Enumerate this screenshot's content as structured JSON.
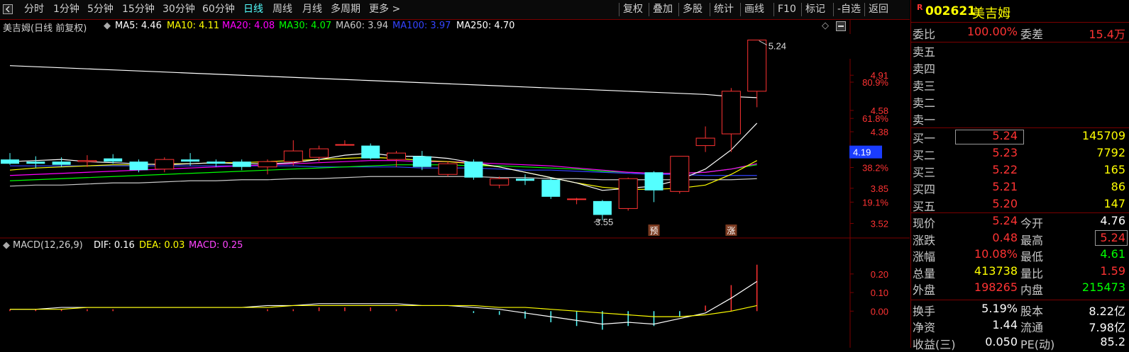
{
  "toolbar": {
    "left_buttons": [
      "分时",
      "1分钟",
      "5分钟",
      "15分钟",
      "30分钟",
      "60分钟",
      "日线",
      "周线",
      "月线",
      "多周期",
      "更多 >"
    ],
    "active": "日线",
    "right_buttons": [
      "复权",
      "叠加",
      "多股",
      "统计",
      "画线",
      "F10",
      "标记",
      "-自选",
      "返回"
    ]
  },
  "chart": {
    "title": "美吉姆(日线 前复权)",
    "ma": [
      {
        "label": "MA5: 4.46",
        "color": "#ffffff"
      },
      {
        "label": "MA10: 4.11",
        "color": "#ffff00"
      },
      {
        "label": "MA20: 4.08",
        "color": "#ff00ff"
      },
      {
        "label": "MA30: 4.07",
        "color": "#00ff00"
      },
      {
        "label": "MA60: 3.94",
        "color": "#c8c8c8"
      },
      {
        "label": "MA100: 3.97",
        "color": "#3344ff"
      },
      {
        "label": "MA250: 4.70",
        "color": "#ffffff"
      }
    ],
    "price_axis": [
      {
        "label": "4.91",
        "v": 4.91,
        "color": "#ff3333"
      },
      {
        "label": "80.9%",
        "v": 4.845,
        "color": "#ff3333"
      },
      {
        "label": "4.58",
        "v": 4.58,
        "color": "#ff3333"
      },
      {
        "label": "61.8%",
        "v": 4.505,
        "color": "#ff3333"
      },
      {
        "label": "4.38",
        "v": 4.38,
        "color": "#ff3333"
      },
      {
        "label": "38.2%",
        "v": 4.045,
        "color": "#ff3333"
      },
      {
        "label": "3.85",
        "v": 3.85,
        "color": "#ff3333"
      },
      {
        "label": "19.1%",
        "v": 3.72,
        "color": "#ff3333"
      },
      {
        "label": "3.52",
        "v": 3.52,
        "color": "#ff3333"
      }
    ],
    "current_price_tag": "4.19",
    "high_label": "5.24",
    "low_label": "3.55",
    "markers": [
      {
        "text": "预",
        "index": 25
      },
      {
        "text": "涨",
        "index": 28
      }
    ],
    "macd_legend": {
      "name": "MACD(12,26,9)",
      "dif": "DIF: 0.16",
      "dea": "DEA: 0.03",
      "macd": "MACD: 0.25"
    },
    "macd_axis": [
      "0.20",
      "0.10",
      "0.00"
    ]
  },
  "chart_data": {
    "type": "candlestick",
    "ohlc": [
      {
        "o": 4.12,
        "h": 4.18,
        "l": 4.07,
        "c": 4.08
      },
      {
        "o": 4.1,
        "h": 4.15,
        "l": 4.04,
        "c": 4.08
      },
      {
        "o": 4.1,
        "h": 4.14,
        "l": 4.05,
        "c": 4.07
      },
      {
        "o": 4.1,
        "h": 4.16,
        "l": 4.05,
        "c": 4.11
      },
      {
        "o": 4.13,
        "h": 4.17,
        "l": 4.08,
        "c": 4.1
      },
      {
        "o": 4.1,
        "h": 4.12,
        "l": 4.0,
        "c": 4.02
      },
      {
        "o": 4.03,
        "h": 4.14,
        "l": 4.0,
        "c": 4.12
      },
      {
        "o": 4.12,
        "h": 4.18,
        "l": 4.06,
        "c": 4.1
      },
      {
        "o": 4.1,
        "h": 4.12,
        "l": 4.05,
        "c": 4.08
      },
      {
        "o": 4.1,
        "h": 4.12,
        "l": 4.02,
        "c": 4.05
      },
      {
        "o": 4.05,
        "h": 4.12,
        "l": 3.98,
        "c": 4.1
      },
      {
        "o": 4.1,
        "h": 4.3,
        "l": 4.06,
        "c": 4.2
      },
      {
        "o": 4.14,
        "h": 4.25,
        "l": 4.1,
        "c": 4.22
      },
      {
        "o": 4.26,
        "h": 4.3,
        "l": 4.25,
        "c": 4.26
      },
      {
        "o": 4.25,
        "h": 4.27,
        "l": 4.12,
        "c": 4.13
      },
      {
        "o": 4.12,
        "h": 4.2,
        "l": 4.05,
        "c": 4.18
      },
      {
        "o": 4.15,
        "h": 4.2,
        "l": 4.02,
        "c": 4.05
      },
      {
        "o": 3.98,
        "h": 4.1,
        "l": 3.96,
        "c": 4.08
      },
      {
        "o": 4.1,
        "h": 4.12,
        "l": 3.93,
        "c": 3.95
      },
      {
        "o": 3.88,
        "h": 3.96,
        "l": 3.85,
        "c": 3.94
      },
      {
        "o": 3.94,
        "h": 3.98,
        "l": 3.88,
        "c": 3.92
      },
      {
        "o": 3.93,
        "h": 3.95,
        "l": 3.75,
        "c": 3.77
      },
      {
        "o": 3.75,
        "h": 3.76,
        "l": 3.7,
        "c": 3.75
      },
      {
        "o": 3.73,
        "h": 3.74,
        "l": 3.55,
        "c": 3.6
      },
      {
        "o": 3.66,
        "h": 3.95,
        "l": 3.64,
        "c": 3.94
      },
      {
        "o": 4.0,
        "h": 4.01,
        "l": 3.72,
        "c": 3.83
      },
      {
        "o": 3.82,
        "h": 4.15,
        "l": 3.8,
        "c": 4.15
      },
      {
        "o": 4.25,
        "h": 4.43,
        "l": 4.19,
        "c": 4.32
      },
      {
        "o": 4.36,
        "h": 4.79,
        "l": 4.19,
        "c": 4.76
      },
      {
        "o": 4.76,
        "h": 5.24,
        "l": 4.61,
        "c": 5.24
      }
    ],
    "ma5": [
      4.1,
      4.11,
      4.12,
      4.1,
      4.09,
      4.08,
      4.07,
      4.08,
      4.09,
      4.08,
      4.08,
      4.09,
      4.12,
      4.16,
      4.18,
      4.15,
      4.15,
      4.13,
      4.09,
      4.05,
      4.0,
      3.95,
      3.9,
      3.83,
      3.85,
      3.87,
      3.93,
      4.03,
      4.21,
      4.46
    ],
    "ma10": [
      4.02,
      4.04,
      4.05,
      4.06,
      4.07,
      4.07,
      4.08,
      4.08,
      4.09,
      4.09,
      4.1,
      4.11,
      4.12,
      4.13,
      4.14,
      4.13,
      4.11,
      4.1,
      4.08,
      4.05,
      4.0,
      3.95,
      3.9,
      3.86,
      3.84,
      3.84,
      3.85,
      3.88,
      3.98,
      4.11
    ],
    "ma20": [
      3.97,
      3.98,
      3.99,
      4.0,
      4.01,
      4.02,
      4.03,
      4.04,
      4.05,
      4.06,
      4.07,
      4.08,
      4.09,
      4.1,
      4.11,
      4.11,
      4.1,
      4.1,
      4.09,
      4.08,
      4.07,
      4.06,
      4.04,
      4.02,
      4.0,
      3.99,
      3.99,
      4.0,
      4.03,
      4.08
    ],
    "ma30": [
      3.92,
      3.93,
      3.94,
      3.95,
      3.96,
      3.97,
      3.98,
      3.99,
      4.0,
      4.01,
      4.02,
      4.03,
      4.04,
      4.05,
      4.06,
      4.07,
      4.07,
      4.07,
      4.06,
      4.06,
      4.05,
      4.04,
      4.03,
      4.01,
      4.0,
      3.99,
      3.99,
      4.0,
      4.03,
      4.07
    ],
    "ma60": [
      3.87,
      3.88,
      3.88,
      3.89,
      3.9,
      3.9,
      3.91,
      3.92,
      3.92,
      3.93,
      3.93,
      3.94,
      3.94,
      3.95,
      3.96,
      3.96,
      3.96,
      3.96,
      3.96,
      3.95,
      3.95,
      3.94,
      3.94,
      3.93,
      3.93,
      3.93,
      3.93,
      3.93,
      3.93,
      3.94
    ],
    "ma100": [
      4.06,
      4.06,
      4.06,
      4.06,
      4.06,
      4.06,
      4.06,
      4.06,
      4.06,
      4.06,
      4.06,
      4.06,
      4.05,
      4.05,
      4.05,
      4.05,
      4.04,
      4.04,
      4.04,
      4.03,
      4.02,
      4.02,
      4.01,
      4.0,
      3.99,
      3.98,
      3.98,
      3.97,
      3.97,
      3.97
    ],
    "ma250": [
      5.0,
      4.99,
      4.98,
      4.97,
      4.96,
      4.95,
      4.94,
      4.93,
      4.92,
      4.91,
      4.9,
      4.89,
      4.88,
      4.87,
      4.86,
      4.85,
      4.84,
      4.83,
      4.82,
      4.81,
      4.8,
      4.79,
      4.78,
      4.77,
      4.76,
      4.75,
      4.74,
      4.73,
      4.71,
      4.7
    ],
    "dif": [
      0.01,
      0.01,
      0.02,
      0.02,
      0.02,
      0.02,
      0.02,
      0.02,
      0.02,
      0.02,
      0.03,
      0.03,
      0.04,
      0.04,
      0.04,
      0.04,
      0.03,
      0.03,
      0.02,
      0.01,
      -0.01,
      -0.03,
      -0.05,
      -0.07,
      -0.06,
      -0.07,
      -0.04,
      -0.01,
      0.07,
      0.16
    ],
    "dea": [
      0.01,
      0.01,
      0.01,
      0.02,
      0.02,
      0.02,
      0.02,
      0.02,
      0.02,
      0.02,
      0.02,
      0.03,
      0.03,
      0.03,
      0.03,
      0.03,
      0.03,
      0.03,
      0.03,
      0.02,
      0.02,
      0.01,
      0.0,
      -0.01,
      -0.02,
      -0.03,
      -0.03,
      -0.02,
      0.0,
      0.03
    ],
    "macd": [
      0.01,
      0.01,
      0.01,
      0.01,
      0.01,
      0.0,
      0.0,
      0.0,
      0.0,
      0.0,
      0.01,
      0.01,
      0.02,
      0.02,
      0.02,
      0.01,
      0.0,
      0.0,
      -0.01,
      -0.02,
      -0.04,
      -0.06,
      -0.08,
      -0.1,
      -0.08,
      -0.08,
      -0.03,
      0.03,
      0.14,
      0.25
    ]
  },
  "quote": {
    "code_badge": "R",
    "code": "002621",
    "name": "美吉姆",
    "weibi_label": "委比",
    "weibi_value": "100.00%",
    "weicha_label": "委差",
    "weicha_value": "15.4万",
    "sell": [
      {
        "label": "卖五",
        "price": "",
        "vol": ""
      },
      {
        "label": "卖四",
        "price": "",
        "vol": ""
      },
      {
        "label": "卖三",
        "price": "",
        "vol": ""
      },
      {
        "label": "卖二",
        "price": "",
        "vol": ""
      },
      {
        "label": "卖一",
        "price": "",
        "vol": ""
      }
    ],
    "buy": [
      {
        "label": "买一",
        "price": "5.24",
        "vol": "145709"
      },
      {
        "label": "买二",
        "price": "5.23",
        "vol": "7792"
      },
      {
        "label": "买三",
        "price": "5.22",
        "vol": "165"
      },
      {
        "label": "买四",
        "price": "5.21",
        "vol": "86"
      },
      {
        "label": "买五",
        "price": "5.20",
        "vol": "147"
      }
    ],
    "stats": [
      {
        "l1": "现价",
        "v1": "5.24",
        "c1": "#ff3333",
        "l2": "今开",
        "v2": "4.76",
        "c2": "#ffffff"
      },
      {
        "l1": "涨跌",
        "v1": "0.48",
        "c1": "#ff3333",
        "l2": "最高",
        "v2": "5.24",
        "c2": "#ff3333"
      },
      {
        "l1": "涨幅",
        "v1": "10.08%",
        "c1": "#ff3333",
        "l2": "最低",
        "v2": "4.61",
        "c2": "#00ff00"
      },
      {
        "l1": "总量",
        "v1": "413738",
        "c1": "#ffff00",
        "l2": "量比",
        "v2": "1.59",
        "c2": "#ff3333"
      },
      {
        "l1": "外盘",
        "v1": "198265",
        "c1": "#ff3333",
        "l2": "内盘",
        "v2": "215473",
        "c2": "#00ff00"
      },
      {
        "l1": "换手",
        "v1": "5.19%",
        "c1": "#ffffff",
        "l2": "股本",
        "v2": "8.22亿",
        "c2": "#ffffff"
      },
      {
        "l1": "净资",
        "v1": "1.44",
        "c1": "#ffffff",
        "l2": "流通",
        "v2": "7.98亿",
        "c2": "#ffffff"
      },
      {
        "l1": "收益(三)",
        "v1": "0.050",
        "c1": "#ffffff",
        "l2": "PE(动)",
        "v2": "85.2",
        "c2": "#ffffff"
      }
    ]
  },
  "colors": {
    "up": "#ff3333",
    "down": "#54ffff",
    "grid": "#7a0000"
  }
}
